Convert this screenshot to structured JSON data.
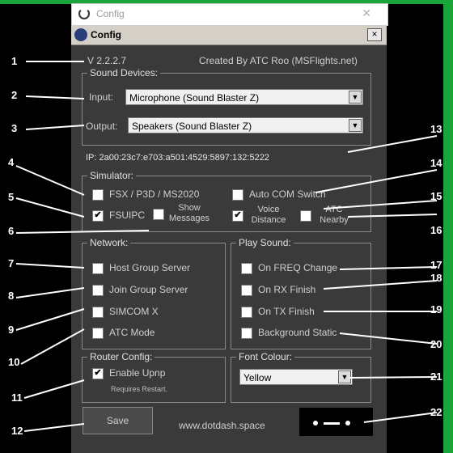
{
  "outer_window": {
    "title": "Config",
    "close_glyph": "✕"
  },
  "window": {
    "title": "Config",
    "close_glyph": "×"
  },
  "header": {
    "version": "V 2.2.2.7",
    "credits": "Created By ATC Roo (MSFlights.net)"
  },
  "sound_devices": {
    "title": "Sound Devices:",
    "input_label": "Input:",
    "input_value": "Microphone (Sound Blaster Z)",
    "output_label": "Output:",
    "output_value": "Speakers (Sound Blaster Z)"
  },
  "ip_text": "IP: 2a00:23c7:e703:a501:4529:5897:132:5222",
  "simulator": {
    "title": "Simulator:",
    "fsx": {
      "label": "FSX / P3D / MS2020",
      "checked": false
    },
    "auto_com": {
      "label": "Auto COM Switch",
      "checked": false
    },
    "fsuipc": {
      "label": "FSUIPC",
      "checked": true
    },
    "show_messages": {
      "label_line1": "Show",
      "label_line2": "Messages",
      "checked": false
    },
    "voice_distance": {
      "label_line1": "Voice",
      "label_line2": "Distance",
      "checked": true
    },
    "atc_nearby": {
      "label_line1": "ATC",
      "label_line2": "Nearby",
      "checked": false
    }
  },
  "network": {
    "title": "Network:",
    "items": [
      {
        "label": "Host Group Server",
        "checked": false
      },
      {
        "label": "Join Group Server",
        "checked": false
      },
      {
        "label": "SIMCOM X",
        "checked": false
      },
      {
        "label": "ATC Mode",
        "checked": false
      }
    ]
  },
  "play_sound": {
    "title": "Play Sound:",
    "items": [
      {
        "label": "On FREQ Change",
        "checked": false
      },
      {
        "label": "On RX Finish",
        "checked": false
      },
      {
        "label": "On TX Finish",
        "checked": false
      },
      {
        "label": "Background Static",
        "checked": false
      }
    ]
  },
  "router_config": {
    "title": "Router Config:",
    "enable_upnp": {
      "label": "Enable Upnp",
      "checked": true
    },
    "note": "Requires Restart."
  },
  "font_colour": {
    "title": "Font Colour:",
    "value": "Yellow"
  },
  "footer": {
    "save_label": "Save",
    "website": "www.dotdash.space"
  },
  "check_glyph": "✔",
  "callouts": [
    "1",
    "2",
    "3",
    "4",
    "5",
    "6",
    "7",
    "8",
    "9",
    "10",
    "11",
    "12",
    "13",
    "14",
    "15",
    "16",
    "17",
    "18",
    "19",
    "20",
    "21",
    "22"
  ],
  "colors": {
    "accent_green": "#1aa53a",
    "window_bg": "#3a3a3a",
    "text": "#cfcfcf"
  }
}
